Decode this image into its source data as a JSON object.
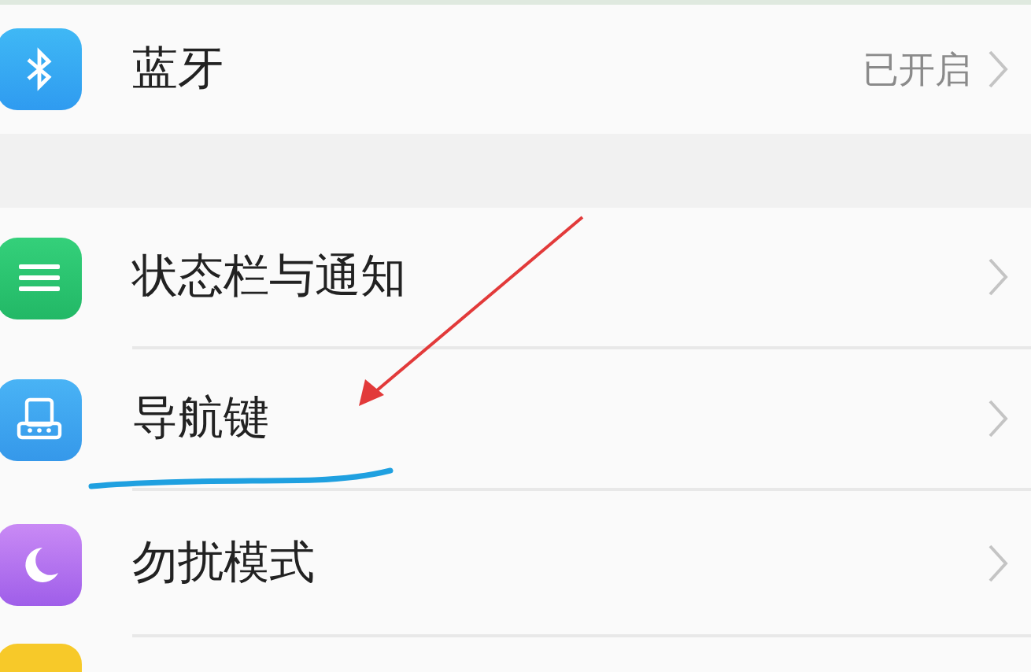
{
  "groups": [
    {
      "items": [
        {
          "label": "蓝牙",
          "value": "已开启"
        }
      ]
    },
    {
      "items": [
        {
          "label": "状态栏与通知"
        },
        {
          "label": "导航键"
        },
        {
          "label": "勿扰模式"
        }
      ]
    }
  ],
  "annotations": {
    "arrow": true,
    "underline": true
  }
}
